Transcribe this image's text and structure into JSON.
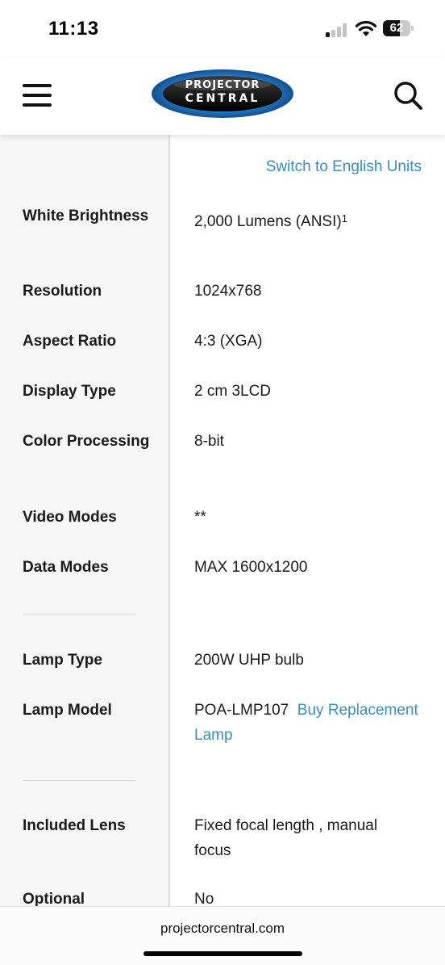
{
  "status_bar": {
    "time": "11:13",
    "battery_level": "62",
    "battery_percent": 62,
    "signal_bars_active": 1,
    "signal_bars_total": 4
  },
  "header": {
    "logo_line1": "PROJECTOR",
    "logo_line2": "CENTRAL",
    "menu_icon": "hamburger-menu-icon",
    "search_icon": "search-icon"
  },
  "units_link": "Switch to English Units",
  "specs": [
    {
      "label": "White Brightness",
      "value": "2,000 Lumens (ANSI)",
      "footnote": "1"
    },
    {
      "label": "Resolution",
      "value": "1024x768"
    },
    {
      "label": "Aspect Ratio",
      "value": "4:3 (XGA)"
    },
    {
      "label": "Display Type",
      "value": "2 cm 3LCD"
    },
    {
      "label": "Color Processing",
      "value": "8-bit"
    },
    {
      "label": "Video Modes",
      "value": "**"
    },
    {
      "label": "Data Modes",
      "value": "MAX 1600x1200"
    },
    {
      "label": "Lamp Type",
      "value": "200W UHP bulb"
    },
    {
      "label": "Lamp Model",
      "value": "POA-LMP107",
      "link": "Buy Replacement Lamp"
    },
    {
      "label": "Included Lens",
      "value": "Fixed focal length , manual focus"
    },
    {
      "label": "Optional",
      "value": "No"
    }
  ],
  "browser": {
    "url": "projectorcentral.com"
  },
  "colors": {
    "link": "#3a8fb7",
    "label_column_bg": "#f6f6f6",
    "logo_blue": "#2e8fd8"
  }
}
